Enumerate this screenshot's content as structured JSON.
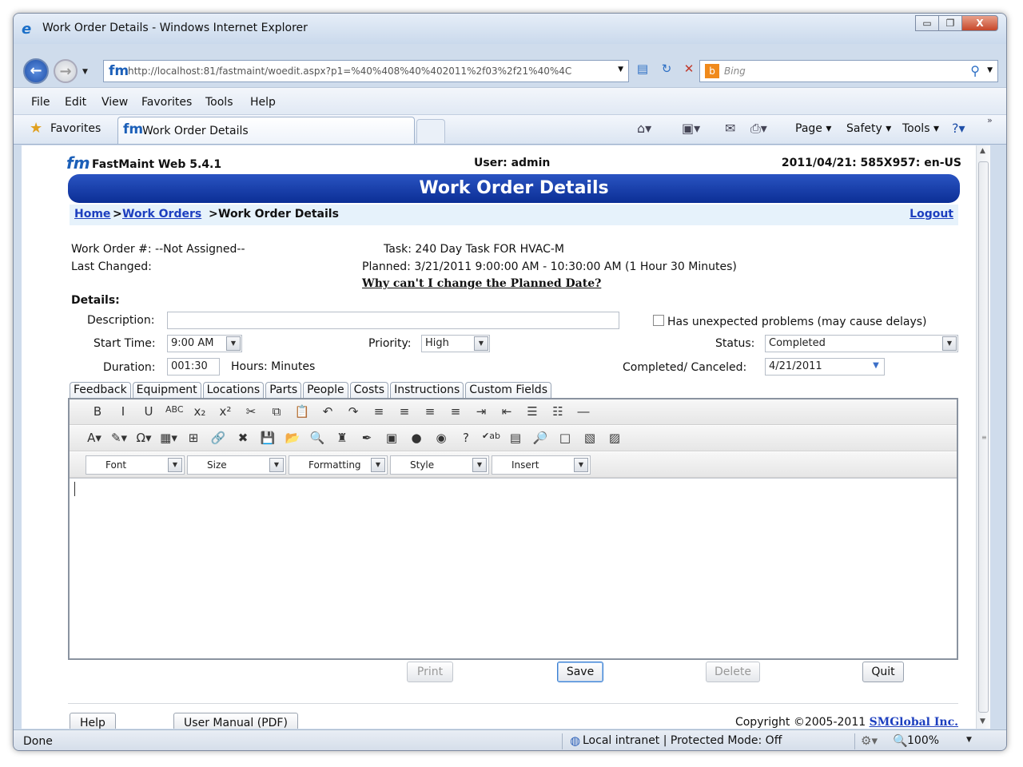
{
  "window": {
    "title": "Work Order Details - Windows Internet Explorer",
    "minimize_glyph": "▭",
    "restore_glyph": "❐",
    "close_glyph": "X"
  },
  "address_bar": {
    "url": "http://localhost:81/fastmaint/woedit.aspx?p1=%40%408%40%402011%2f03%2f21%40%4C",
    "search_placeholder": "Bing"
  },
  "menu": [
    "File",
    "Edit",
    "View",
    "Favorites",
    "Tools",
    "Help"
  ],
  "favorites_bar": {
    "favorites_label": "Favorites",
    "tab_title": "Work Order Details",
    "commands": [
      "Page ▾",
      "Safety ▾",
      "Tools ▾"
    ]
  },
  "page": {
    "app_name": "FastMaint Web 5.4.1",
    "user": "User: admin",
    "session": "2011/04/21: 585X957: en-US",
    "banner_title": "Work Order Details",
    "breadcrumb": {
      "home": "Home",
      "sep1": ">",
      "work_orders": "Work Orders",
      "sep2": ">",
      "current": "Work Order Details"
    },
    "logout": "Logout",
    "work_order_number": "Work Order #: --Not Assigned--",
    "last_changed": "Last Changed:",
    "task": "Task: 240 Day Task FOR HVAC-M",
    "planned": "Planned: 3/21/2011 9:00:00 AM - 10:30:00 AM (1 Hour 30 Minutes)",
    "why_link": "Why can't I change the Planned Date?",
    "details_heading": "Details:",
    "description_label": "Description:",
    "description_value": "",
    "unexpected_label": "Has unexpected problems (may cause delays)",
    "start_time_label": "Start Time:",
    "start_time_value": "9:00 AM",
    "priority_label": "Priority:",
    "priority_value": "High",
    "status_label": "Status:",
    "status_value": "Completed",
    "duration_label": "Duration:",
    "duration_value": "001:30",
    "duration_unit": "Hours: Minutes",
    "completed_label": "Completed/ Canceled:",
    "completed_value": "4/21/2011",
    "tabs": [
      "Feedback",
      "Equipment",
      "Locations",
      "Parts",
      "People",
      "Costs",
      "Instructions",
      "Custom Fields"
    ],
    "editor_dropdowns": [
      "Font",
      "Size",
      "Formatting",
      "Style",
      "Insert"
    ],
    "buttons": {
      "print": "Print",
      "save": "Save",
      "delete": "Delete",
      "quit": "Quit",
      "help": "Help",
      "user_manual": "User Manual (PDF)"
    },
    "copyright_text": "Copyright ©2005-2011 ",
    "copyright_link": "SMGlobal Inc."
  },
  "status_bar": {
    "done": "Done",
    "zone": "Local intranet | Protected Mode: Off",
    "zoom": "100%"
  },
  "toolbar_icons_row1": [
    {
      "name": "bold-icon",
      "glyph": "B"
    },
    {
      "name": "italic-icon",
      "glyph": "I"
    },
    {
      "name": "underline-icon",
      "glyph": "U"
    },
    {
      "name": "strikethrough-icon",
      "glyph": "ABC"
    },
    {
      "name": "subscript-icon",
      "glyph": "x₂"
    },
    {
      "name": "superscript-icon",
      "glyph": "x²"
    },
    {
      "name": "cut-icon",
      "glyph": "✂"
    },
    {
      "name": "copy-icon",
      "glyph": "⧉"
    },
    {
      "name": "paste-icon",
      "glyph": "📋"
    },
    {
      "name": "undo-icon",
      "glyph": "↶"
    },
    {
      "name": "redo-icon",
      "glyph": "↷"
    },
    {
      "name": "align-left-icon",
      "glyph": "≡"
    },
    {
      "name": "align-center-icon",
      "glyph": "≡"
    },
    {
      "name": "align-right-icon",
      "glyph": "≡"
    },
    {
      "name": "justify-icon",
      "glyph": "≡"
    },
    {
      "name": "indent-icon",
      "glyph": "⇥"
    },
    {
      "name": "outdent-icon",
      "glyph": "⇤"
    },
    {
      "name": "bullet-list-icon",
      "glyph": "☰"
    },
    {
      "name": "numbered-list-icon",
      "glyph": "☷"
    },
    {
      "name": "horizontal-rule-icon",
      "glyph": "―"
    }
  ],
  "toolbar_icons_row2": [
    {
      "name": "font-color-icon",
      "glyph": "A▾"
    },
    {
      "name": "highlight-icon",
      "glyph": "✎▾"
    },
    {
      "name": "special-char-icon",
      "glyph": "Ω▾"
    },
    {
      "name": "table-icon",
      "glyph": "▦▾"
    },
    {
      "name": "table-grid-icon",
      "glyph": "⊞"
    },
    {
      "name": "hyperlink-icon",
      "glyph": "🔗"
    },
    {
      "name": "unlink-icon",
      "glyph": "✖"
    },
    {
      "name": "save-doc-icon",
      "glyph": "💾"
    },
    {
      "name": "open-icon",
      "glyph": "📂"
    },
    {
      "name": "preview-icon",
      "glyph": "🔍"
    },
    {
      "name": "find-icon",
      "glyph": "♜"
    },
    {
      "name": "pen-icon",
      "glyph": "✒"
    },
    {
      "name": "image-icon",
      "glyph": "▣"
    },
    {
      "name": "flash-icon",
      "glyph": "●"
    },
    {
      "name": "media-icon",
      "glyph": "◉"
    },
    {
      "name": "help-icon",
      "glyph": "?"
    },
    {
      "name": "spellcheck-icon",
      "glyph": "✔ab"
    },
    {
      "name": "template-icon",
      "glyph": "▤"
    },
    {
      "name": "zoom-icon",
      "glyph": "🔎"
    },
    {
      "name": "form-icon",
      "glyph": "□"
    },
    {
      "name": "paste-word-icon",
      "glyph": "▧"
    },
    {
      "name": "paste-text-icon",
      "glyph": "▨"
    }
  ]
}
